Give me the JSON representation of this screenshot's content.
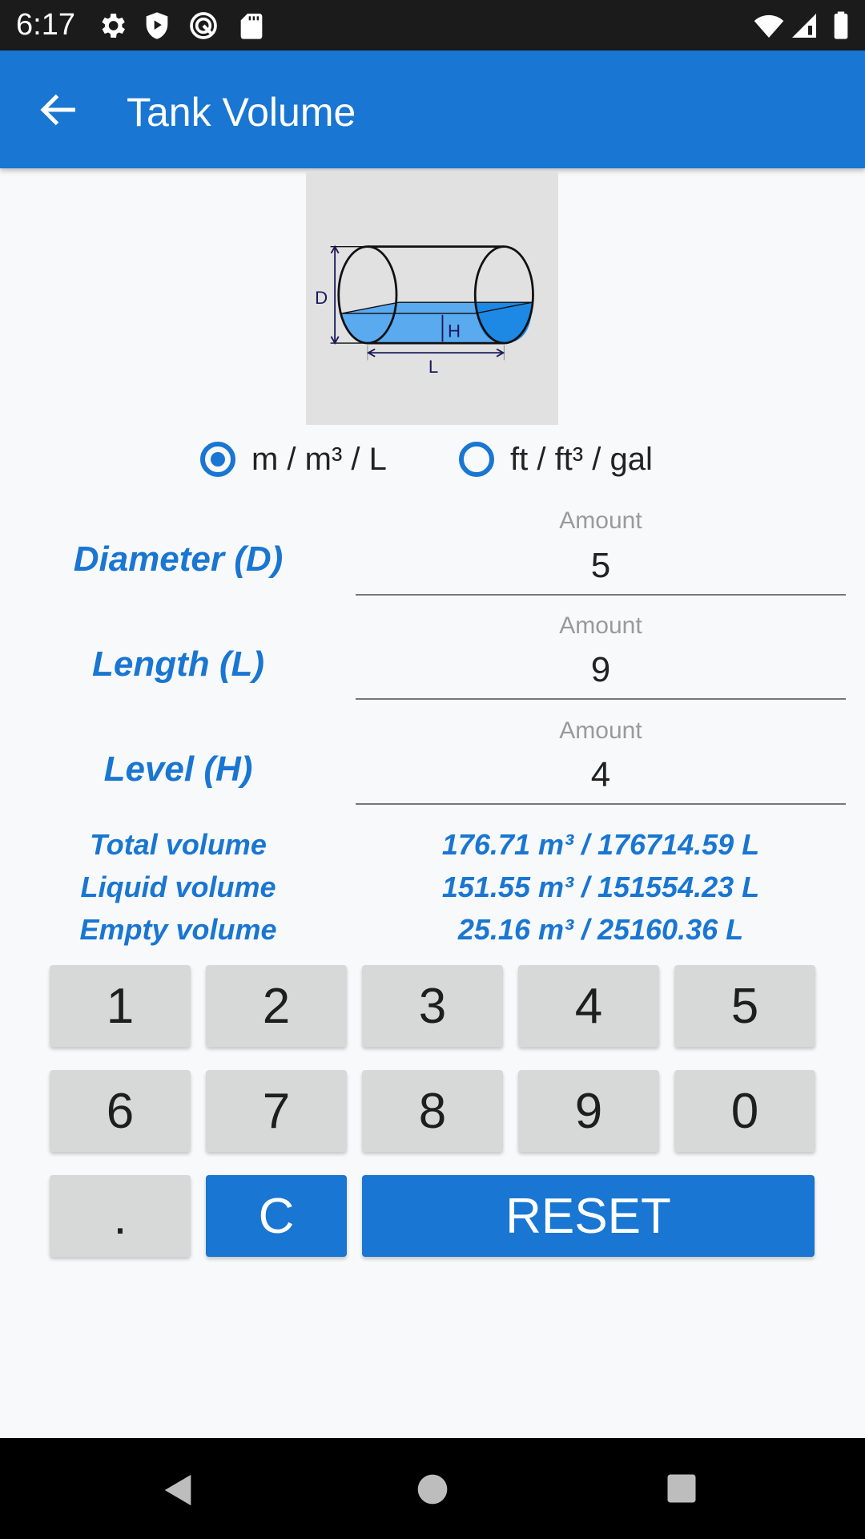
{
  "status_bar": {
    "time": "6:17",
    "left_icons": [
      "gear-icon",
      "shield-play-icon",
      "q-logo-icon",
      "sd-card-icon"
    ],
    "right_icons": [
      "wifi-icon",
      "signal-icon",
      "battery-icon"
    ]
  },
  "app_bar": {
    "title": "Tank Volume",
    "back_icon": "arrow-back-icon"
  },
  "diagram": {
    "labels": {
      "diameter": "D",
      "level": "H",
      "length": "L"
    },
    "colors": {
      "liquid": "#5aaaf0",
      "liquid_end": "#1e88e5",
      "background": "#e1e1e1",
      "dimension": "#1a1a5e"
    }
  },
  "units": {
    "options": [
      {
        "label": "m / m³ / L",
        "selected": true
      },
      {
        "label": "ft / ft³ / gal",
        "selected": false
      }
    ]
  },
  "fields": [
    {
      "label": "Diameter (D)",
      "hint": "Amount",
      "value": "5"
    },
    {
      "label": "Length (L)",
      "hint": "Amount",
      "value": "9"
    },
    {
      "label": "Level (H)",
      "hint": "Amount",
      "value": "4"
    }
  ],
  "results": [
    {
      "label": "Total volume",
      "value": "176.71 m³ / 176714.59 L"
    },
    {
      "label": "Liquid volume",
      "value": "151.55 m³ / 151554.23 L"
    },
    {
      "label": "Empty volume",
      "value": "25.16 m³ / 25160.36 L"
    }
  ],
  "keypad": {
    "digits": [
      "1",
      "2",
      "3",
      "4",
      "5",
      "6",
      "7",
      "8",
      "9",
      "0"
    ],
    "dot": ".",
    "clear": "C",
    "reset": "RESET"
  },
  "colors": {
    "accent": "#1976d2",
    "key_bg": "#d7d8d8",
    "background": "#f8f9fa"
  },
  "nav_bar": {
    "icons": [
      "back-triangle-icon",
      "home-circle-icon",
      "recents-square-icon"
    ]
  }
}
